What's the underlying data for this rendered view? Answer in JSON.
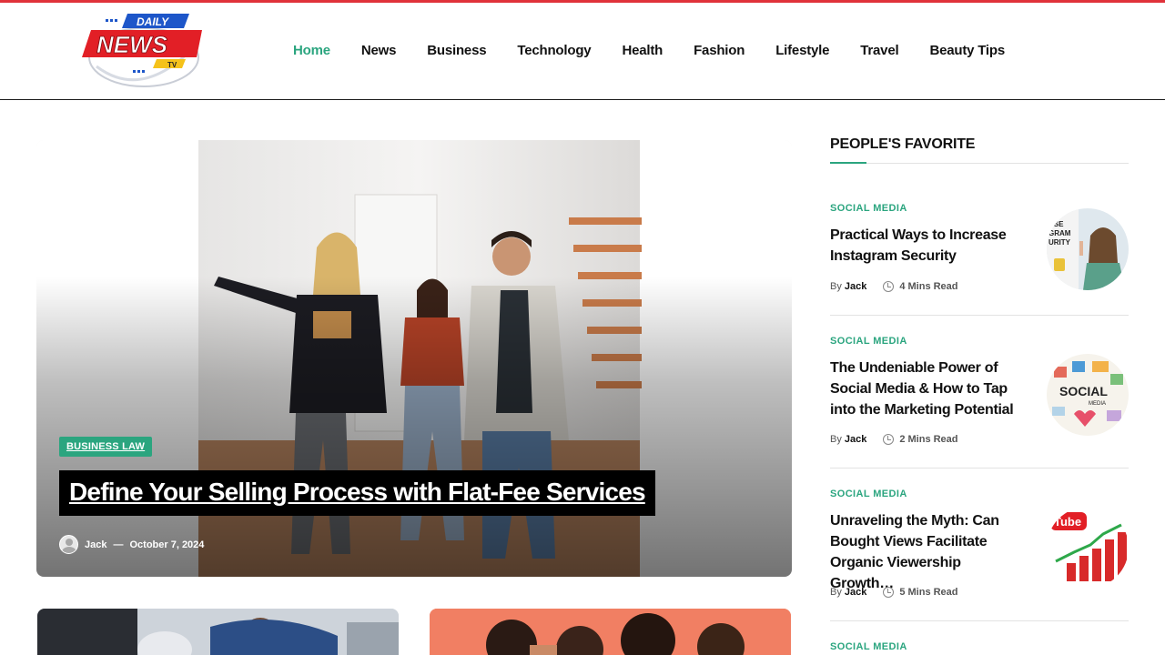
{
  "brand": {
    "logo_daily": "DAILY",
    "logo_news": "NEWS",
    "logo_tv": "TV",
    "accent": "#2ba57f",
    "top_bar": "#e0323a"
  },
  "nav": {
    "items": [
      {
        "label": "Home",
        "active": true
      },
      {
        "label": "News"
      },
      {
        "label": "Business"
      },
      {
        "label": "Technology"
      },
      {
        "label": "Health"
      },
      {
        "label": "Fashion"
      },
      {
        "label": "Lifestyle"
      },
      {
        "label": "Travel"
      },
      {
        "label": "Beauty Tips"
      }
    ]
  },
  "hero": {
    "category": "BUSINESS LAW",
    "title": "Define Your Selling Process with Flat-Fee Services",
    "author": "Jack",
    "separator": "—",
    "date": "October 7, 2024"
  },
  "sidebar": {
    "title": "PEOPLE'S FAVORITE",
    "items": [
      {
        "category": "SOCIAL MEDIA",
        "title": "Practical Ways to Increase Instagram Security",
        "by": "By",
        "author": "Jack",
        "read": "4 Mins Read",
        "thumb_text": "ASE GRAM URITY"
      },
      {
        "category": "SOCIAL MEDIA",
        "title": "The Undeniable Power of Social Media & How to Tap into the Marketing Potential",
        "by": "By",
        "author": "Jack",
        "read": "2 Mins Read",
        "thumb_text": "SOCIAL MEDIA"
      },
      {
        "category": "SOCIAL MEDIA",
        "title": "Unraveling the Myth: Can Bought Views Facilitate Organic Viewership Growth…",
        "by": "By",
        "author": "Jack",
        "read": "5 Mins Read",
        "thumb_text": "Tube"
      },
      {
        "category": "SOCIAL MEDIA"
      }
    ]
  }
}
